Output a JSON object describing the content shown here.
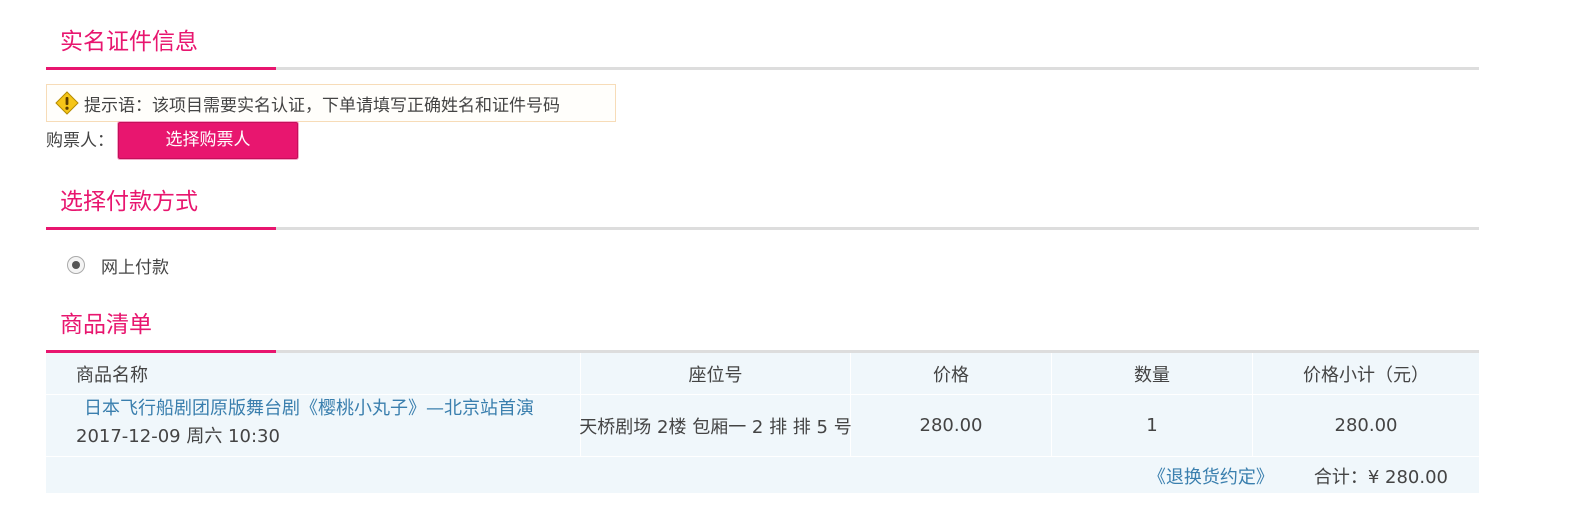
{
  "sections": {
    "realname": {
      "title": "实名证件信息"
    },
    "payment": {
      "title": "选择付款方式"
    },
    "goods": {
      "title": "商品清单"
    }
  },
  "tip": {
    "text": "提示语：该项目需要实名认证，下单请填写正确姓名和证件号码"
  },
  "buyer": {
    "label": "购票人：",
    "button": "选择购票人"
  },
  "payment": {
    "option": "网上付款",
    "selected": true
  },
  "goods_table": {
    "headers": [
      "商品名称",
      "座位号",
      "价格",
      "数量",
      "价格小计（元）"
    ],
    "rows": [
      {
        "name": "日本飞行船剧团原版舞台剧《樱桃小丸子》—北京站首演",
        "date": "2017-12-09 周六 10:30",
        "seat": "天桥剧场 2楼 包厢一 2 排 排 5 号",
        "price": "280.00",
        "quantity": "1",
        "subtotal": "280.00"
      }
    ],
    "policy_link": "《退换货约定》",
    "total": "合计：¥ 280.00"
  },
  "colors": {
    "accent": "#e8166f",
    "link": "#3a7fae",
    "table_bg": "#f0f7fb"
  },
  "icons": {
    "tip": "warning-icon"
  }
}
